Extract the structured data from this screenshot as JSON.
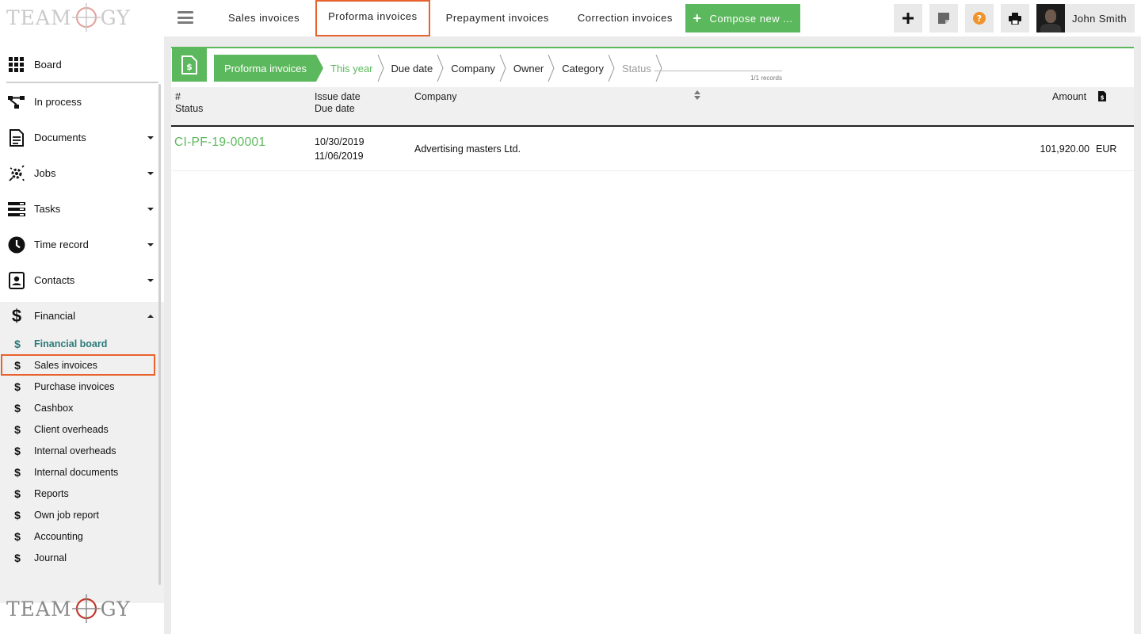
{
  "brand": {
    "logo_left": "TEAM",
    "logo_right": "GY"
  },
  "header": {
    "tabs": [
      "Sales invoices",
      "Proforma invoices",
      "Prepayment invoices",
      "Correction invoices"
    ],
    "compose_label": "Compose new ...",
    "icons": [
      "plus-icon",
      "sticky-note-icon",
      "help-icon",
      "print-icon"
    ],
    "user_name": "John Smith"
  },
  "sidebar": {
    "items": [
      {
        "label": "Board",
        "icon": "grid-icon"
      },
      {
        "label": "In process",
        "icon": "flow-icon"
      },
      {
        "label": "Documents",
        "icon": "document-icon"
      },
      {
        "label": "Jobs",
        "icon": "jobs-icon"
      },
      {
        "label": "Tasks",
        "icon": "tasks-icon"
      },
      {
        "label": "Time record",
        "icon": "clock-icon"
      },
      {
        "label": "Contacts",
        "icon": "contacts-icon"
      },
      {
        "label": "Financial",
        "icon": "dollar-icon"
      }
    ],
    "financial_sub": [
      "Financial board",
      "Sales invoices",
      "Purchase invoices",
      "Cashbox",
      "Client overheads",
      "Internal overheads",
      "Internal documents",
      "Reports",
      "Own job report",
      "Accounting",
      "Journal"
    ]
  },
  "filters": {
    "crumbs": [
      "Proforma invoices",
      "This year",
      "Due date",
      "Company",
      "Owner",
      "Category",
      "Status"
    ],
    "search_placeholder": "",
    "records": "1/1 records"
  },
  "table": {
    "headers": {
      "num": "#",
      "status": "Status",
      "issue_date": "Issue date",
      "due_date": "Due date",
      "company": "Company",
      "amount": "Amount"
    },
    "rows": [
      {
        "number": "CI-PF-19-00001",
        "issue_date": "10/30/2019",
        "due_date": "11/06/2019",
        "company": "Advertising masters Ltd.",
        "amount": "101,920.00",
        "currency": "EUR"
      }
    ]
  },
  "colors": {
    "accent": "#5cb85c",
    "highlight": "#e8622d",
    "teal": "#2b7a78",
    "help": "#f0932b"
  }
}
